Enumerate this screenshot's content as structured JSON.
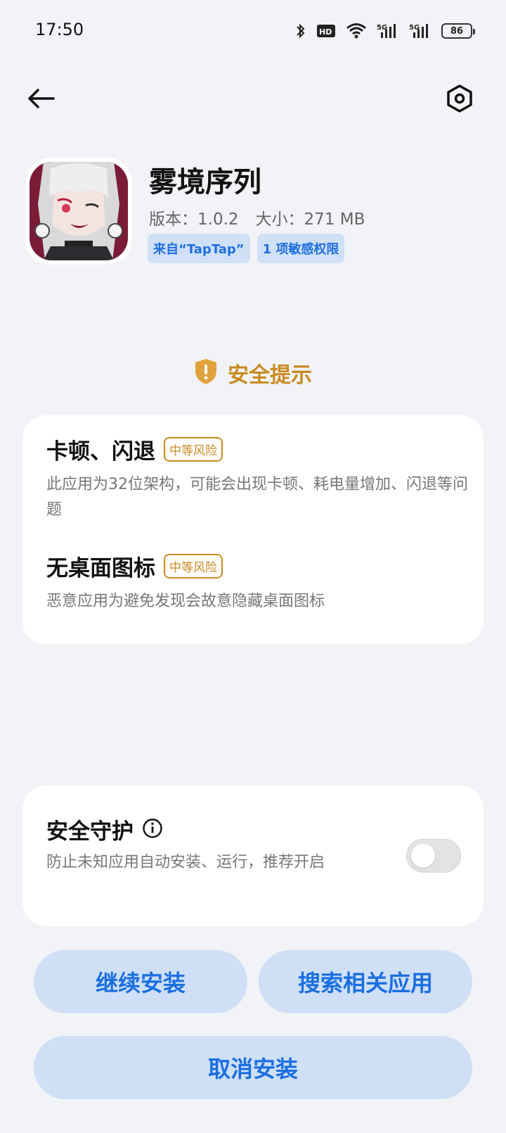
{
  "status_bar": {
    "time": "17:50",
    "battery": "86",
    "icons": [
      "bluetooth-icon",
      "hd-icon",
      "wifi-icon",
      "5g-signal-icon",
      "5g-signal-icon",
      "battery-icon"
    ]
  },
  "nav": {
    "back_icon": "back-arrow-icon",
    "settings_icon": "settings-hexagon-icon"
  },
  "app": {
    "name": "雾境序列",
    "version": "版本：1.0.2",
    "size": "大小：271 MB",
    "tags": [
      "来自“TapTap”",
      "1 项敏感权限"
    ]
  },
  "security": {
    "title": "安全提示",
    "risks": [
      {
        "title": "卡顿、闪退",
        "badge": "中等风险",
        "desc": "此应用为32位架构，可能会出现卡顿、耗电量增加、闪退等问题"
      },
      {
        "title": "无桌面图标",
        "badge": "中等风险",
        "desc": "恶意应用为避免发现会故意隐藏桌面图标"
      }
    ]
  },
  "protect": {
    "title": "安全守护",
    "desc": "防止未知应用自动安装、运行，推荐开启",
    "enabled": false
  },
  "buttons": {
    "continue": "继续安装",
    "search": "搜索相关应用",
    "cancel": "取消安装"
  },
  "colors": {
    "accent": "#1a6fe0",
    "warning": "#c98a22",
    "background": "#f1f3f6",
    "button_bg": "#cfdff5"
  }
}
